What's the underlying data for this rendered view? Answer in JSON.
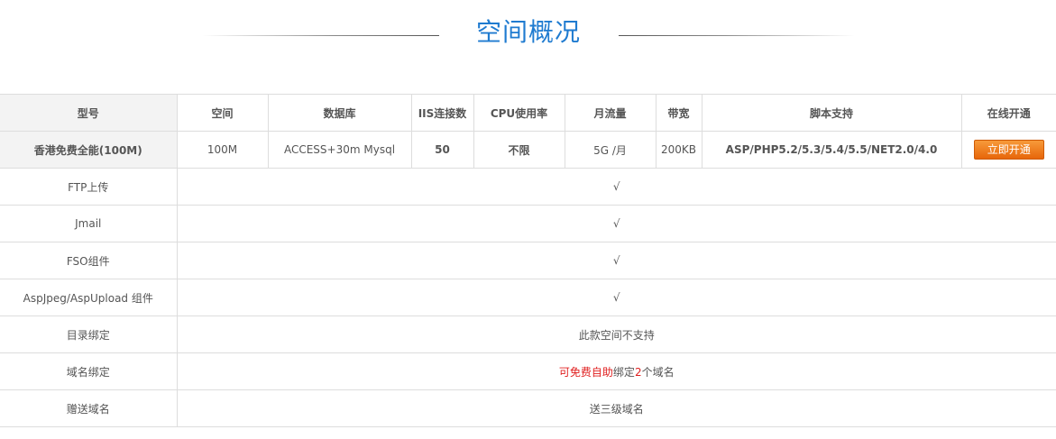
{
  "section": {
    "title": "空间概况"
  },
  "table": {
    "headers": [
      "型号",
      "空间",
      "数据库",
      "IIS连接数",
      "CPU使用率",
      "月流量",
      "带宽",
      "脚本支持",
      "在线开通"
    ],
    "product": {
      "model": "香港免费全能(100M)",
      "space": "100M",
      "database": "ACCESS+30m Mysql",
      "iis_connections": "50",
      "cpu": "不限",
      "monthly_traffic": "5G /月",
      "bandwidth": "200KB",
      "scripts": "ASP/PHP5.2/5.3/5.4/5.5/NET2.0/4.0",
      "action_label": "立即开通"
    },
    "features": [
      {
        "label": "FTP上传",
        "value": "√"
      },
      {
        "label": "Jmail",
        "value": "√"
      },
      {
        "label": "FSO组件",
        "value": "√"
      },
      {
        "label": "AspJpeg/AspUpload 组件",
        "value": "√"
      },
      {
        "label": "目录绑定",
        "value": "此款空间不支持"
      }
    ],
    "domain_binding": {
      "label": "域名绑定",
      "prefix": "可",
      "highlight": "免费自助",
      "middle": "绑定",
      "count": "2",
      "suffix": "个域名"
    },
    "gift_domain": {
      "label": "赠送域名",
      "value": "送三级域名"
    }
  },
  "colors": {
    "title": "#1f7bd0",
    "highlight": "#e02020",
    "button": "#ef7a1e"
  }
}
